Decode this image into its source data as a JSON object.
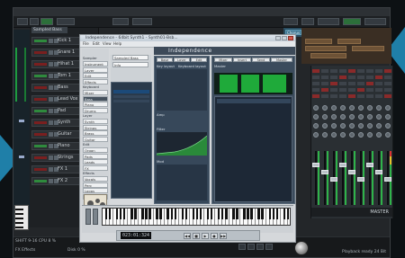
{
  "transcription_note": "Most text in this screenshot is too small to read reliably. Labels and values below are approximate readings, not exact transcriptions.",
  "plugin": {
    "title": "Independence - 64bit Synth1 - Synth01-Bsb...",
    "name": "Independence",
    "menus": [
      "File",
      "Edit",
      "View",
      "Help"
    ],
    "left_heads": [
      "Sampler",
      "Keyboard",
      "Layer",
      "Edit",
      "Effects",
      "Mixer"
    ],
    "left_rows": [
      "Instrument",
      "Layer",
      "Edit",
      "Effects",
      "Mixer",
      "Bass",
      "Piano",
      "Drums",
      "Synth",
      "Strings",
      "Brass",
      "Guitar",
      "Organ",
      "Pads",
      "Leads",
      "FX",
      "Vocals",
      "Perc",
      "Loops",
      "Kits"
    ],
    "col2_fields": [
      "Sampled Bass",
      "Info"
    ],
    "mid_tabs": [
      "Base",
      "Layer",
      "Edit"
    ],
    "mid_heads": [
      "Key layout",
      "Keyboard layout",
      "Amp",
      "Filter",
      "Mod"
    ],
    "right_tabs": [
      "Mixer",
      "Insert",
      "Send",
      "Master"
    ],
    "right_label": "Master",
    "time": "023:01:324",
    "transport_buttons": [
      "◀◀",
      "■",
      "▶",
      "●",
      "▶▶"
    ],
    "close_label": "x"
  },
  "daw": {
    "tracks": [
      "Kick 1",
      "Snare 1",
      "Hihat 1",
      "Tom 1",
      "Bass",
      "Lead Vox",
      "Pad",
      "Synth",
      "Guitar",
      "Piano",
      "Strings",
      "FX 1",
      "FX 2"
    ],
    "track_label": "Sampled Bass",
    "clip_labels": [
      "Chorus",
      "Verse",
      "Bridge",
      "Chorus 2",
      "Outro"
    ],
    "mixer_label": "MASTER",
    "status_left": "SHIFT 9-16  CPU 8 %",
    "status_mid": "Disk  0 %",
    "status_right": "Playback ready  24 Bit",
    "bottom_left": "FX  Effects"
  },
  "colors": {
    "accent": "#1f7fa8",
    "meter_green": "#2fb34a",
    "plugin_header": "#3d4a59"
  }
}
